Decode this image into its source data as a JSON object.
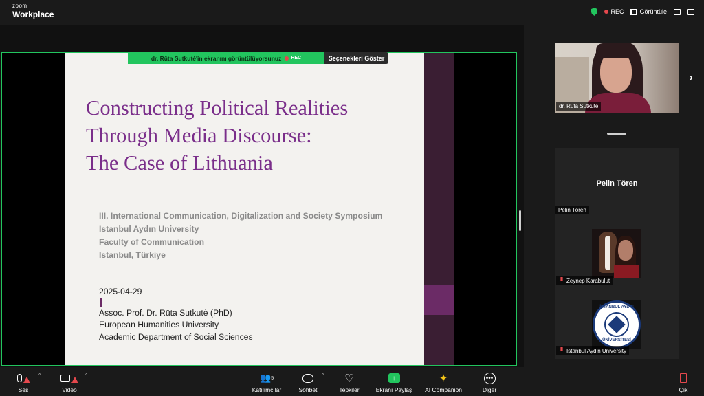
{
  "app": {
    "brand_small": "zoom",
    "brand_big": "Workplace"
  },
  "top_right": {
    "rec_label": "REC",
    "view_label": "Görüntüle"
  },
  "share_banner": {
    "text": "dr. Rūta Sutkutė'in ekranını görüntülüyorsunuz",
    "rec_label": "REC",
    "options_label": "Seçenekleri Göster"
  },
  "slide": {
    "title_lines": [
      "Constructing Political Realities",
      "Through Media Discourse:",
      "The Case of Lithuania"
    ],
    "subtitle_lines": [
      "III. International Communication, Digitalization and Society Symposium",
      "Istanbul Aydın University",
      "Faculty of Communication",
      "Istanbul, Türkiye"
    ],
    "author_lines": [
      "2025-04-29",
      "Assoc. Prof. Dr. Rūta Sutkutė (PhD)",
      "European Humanities University",
      "Academic Department of Social Sciences"
    ]
  },
  "participants": {
    "speaker_name": "dr. Rūta Sutkutė",
    "gallery_title": "Pelin Tören",
    "gallery_label": "Pelin Tören",
    "tile_1": "Zeynep Karabulut",
    "tile_2": "Istanbul Aydin University",
    "seal_top": "İSTANBUL AYDIN",
    "seal_bottom": "ÜNİVERSİTESİ"
  },
  "toolbar": {
    "audio": "Ses",
    "video": "Video",
    "participants": "Katılımcılar",
    "participants_count": "5",
    "chat": "Sohbet",
    "reactions": "Tepkiler",
    "share": "Ekranı Paylaş",
    "ai": "AI Companion",
    "more": "Diğer",
    "leave": "Çık"
  }
}
